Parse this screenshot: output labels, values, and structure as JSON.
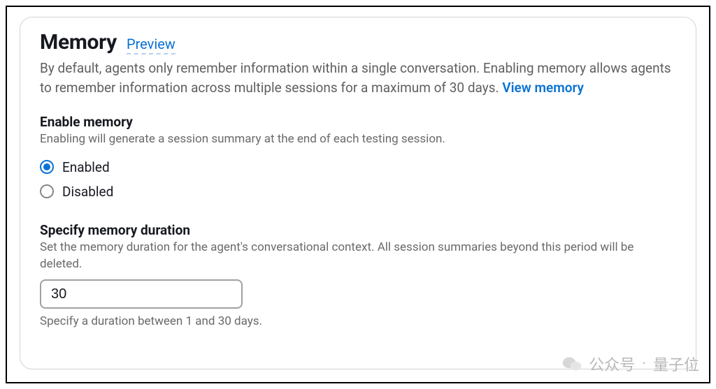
{
  "header": {
    "title": "Memory",
    "preview_badge": "Preview"
  },
  "description": {
    "text_before_link": "By default, agents only remember information within a single conversation. Enabling memory allows agents to remember information across multiple sessions for a maximum of 30 days. ",
    "link_text": "View memory"
  },
  "enable_memory": {
    "label": "Enable memory",
    "sub": "Enabling will generate a session summary at the end of each testing session.",
    "option_enabled": "Enabled",
    "option_disabled": "Disabled",
    "selected": "enabled"
  },
  "duration": {
    "label": "Specify memory duration",
    "sub": "Set the memory duration for the agent's conversational context. All session summaries beyond this period will be deleted.",
    "value": "30",
    "hint": "Specify a duration between 1 and 30 days."
  },
  "watermark": {
    "prefix": "公众号",
    "dot": "·",
    "name": "量子位"
  }
}
